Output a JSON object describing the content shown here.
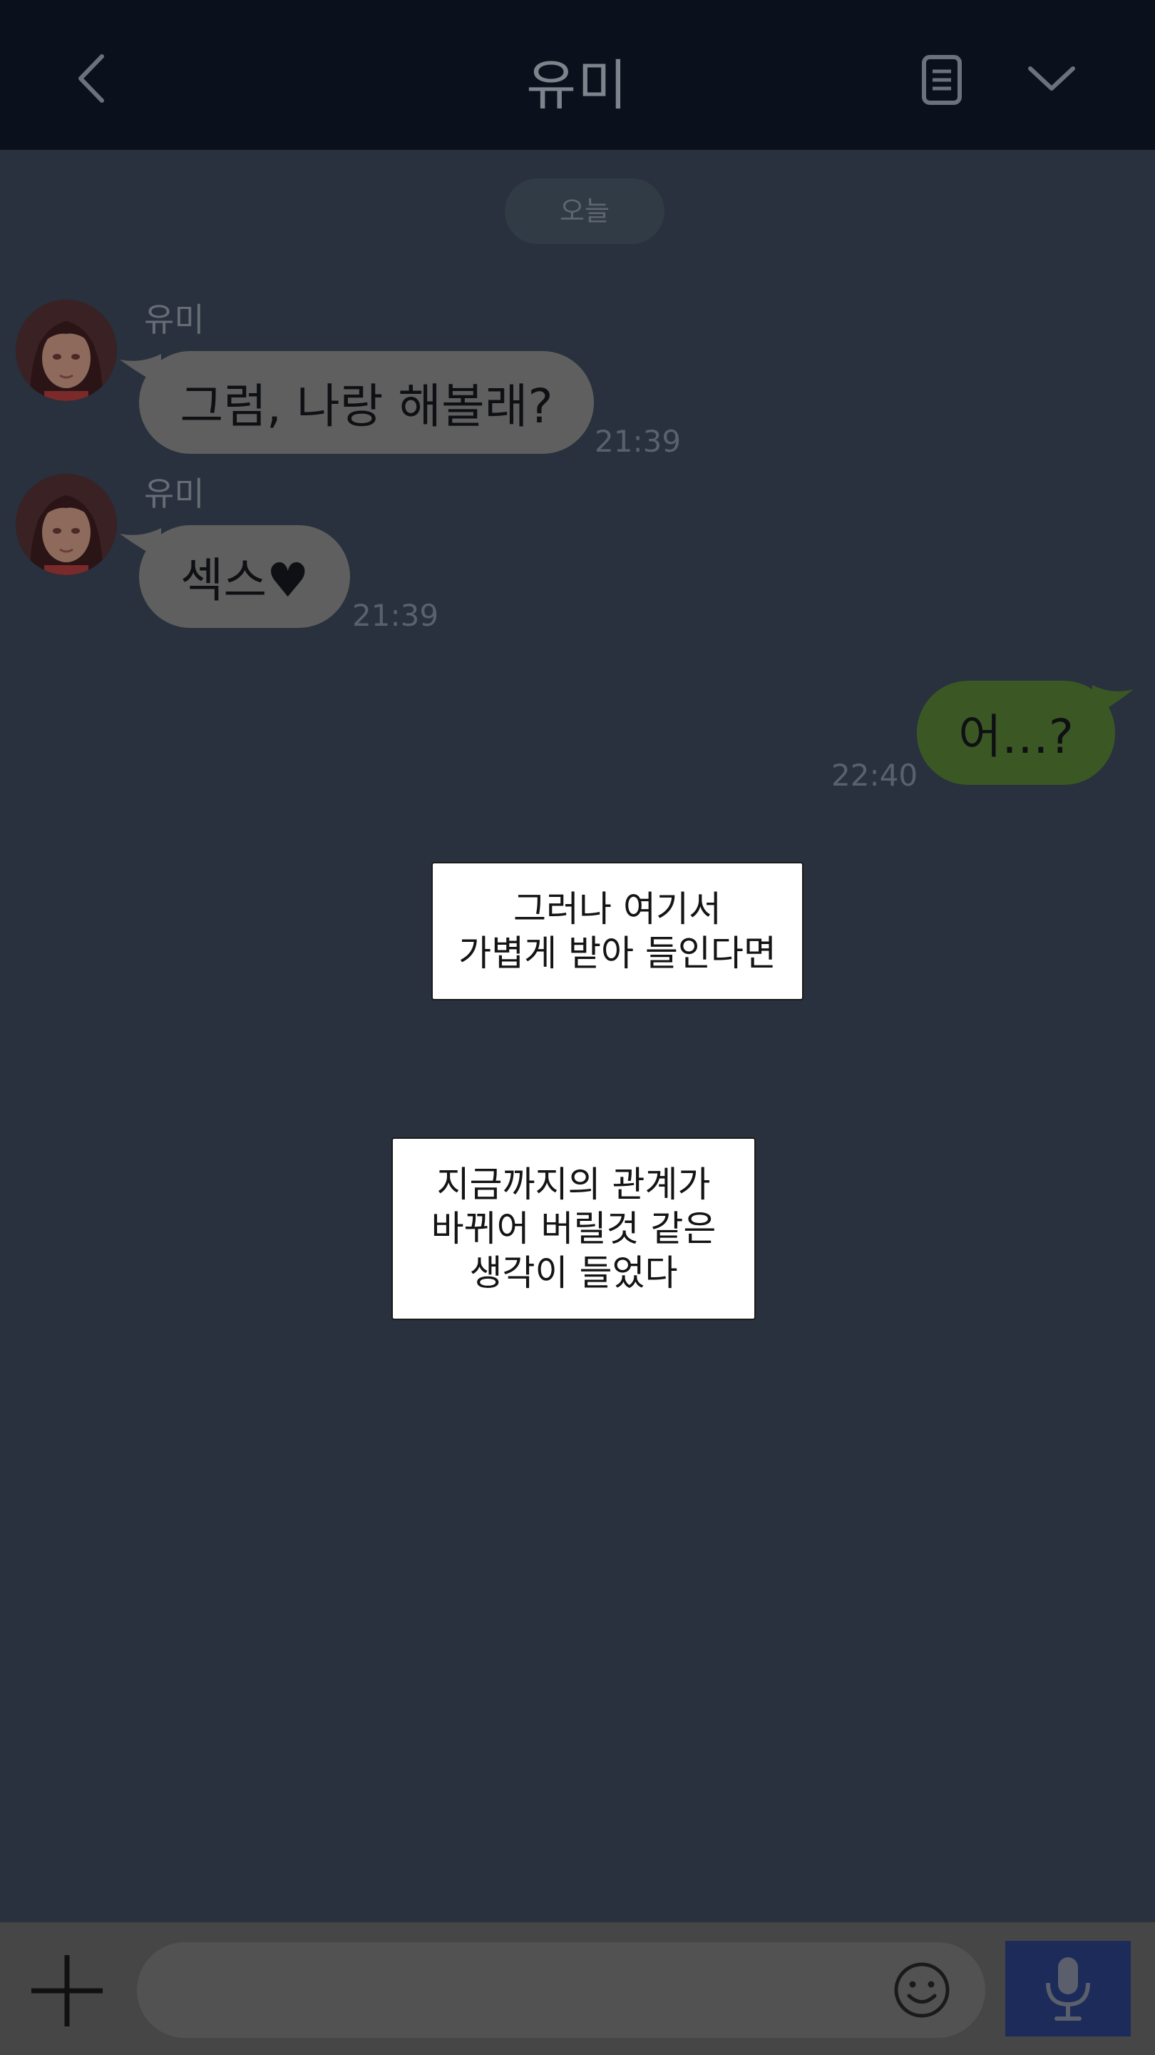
{
  "header": {
    "title": "유미",
    "back_icon": "chevron-left-icon",
    "note_icon": "document-icon",
    "menu_icon": "chevron-down-icon"
  },
  "date_label": "오늘",
  "messages": [
    {
      "sender": "유미",
      "text": "그럼, 나랑 해볼래?",
      "time": "21:39",
      "direction": "in"
    },
    {
      "sender": "유미",
      "text": "섹스♥",
      "time": "21:39",
      "direction": "in"
    },
    {
      "text": "어…?",
      "time": "22:40",
      "direction": "out"
    }
  ],
  "narrations": [
    {
      "lines": [
        "그러나 여기서",
        "가볍게 받아 들인다면"
      ]
    },
    {
      "lines": [
        "지금까지의 관계가",
        "바뀌어 버릴것 같은",
        "생각이 들었다"
      ]
    }
  ],
  "input": {
    "value": "",
    "placeholder": ""
  },
  "colors": {
    "header_bg": "#0b111c",
    "chat_bg": "#28313d",
    "incoming_bubble": "#5f5f5f",
    "outgoing_bubble": "#3b5824",
    "mic_button": "#1c2b5a"
  }
}
